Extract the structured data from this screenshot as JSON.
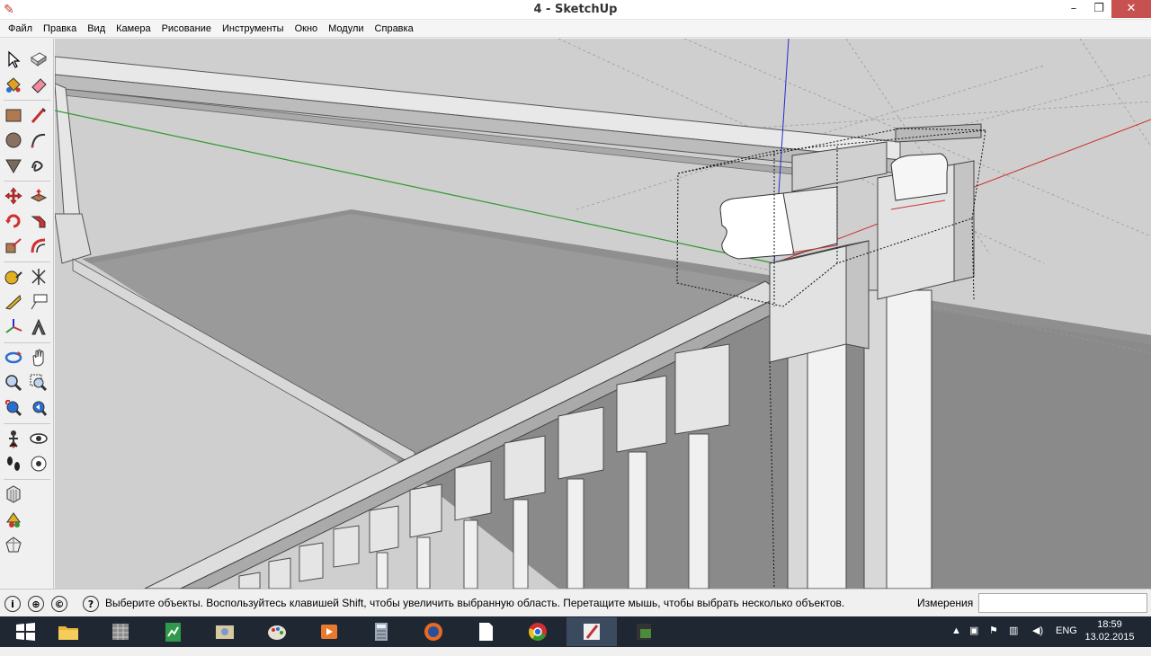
{
  "window": {
    "title": "4 - SketchUp",
    "minimize": "–",
    "restore": "❐",
    "close": "✕"
  },
  "menu": {
    "items": [
      "Файл",
      "Правка",
      "Вид",
      "Камера",
      "Рисование",
      "Инструменты",
      "Окно",
      "Модули",
      "Справка"
    ]
  },
  "tools": [
    "select-icon",
    "make-component-icon",
    "paint-bucket-icon",
    "eraser-icon",
    "rectangle-icon",
    "line-icon",
    "circle-icon",
    "arc-icon",
    "polygon-icon",
    "freehand-icon",
    "move-icon",
    "push-pull-icon",
    "rotate-icon",
    "follow-me-icon",
    "scale-icon",
    "offset-icon",
    "tape-measure-icon",
    "dimension-icon",
    "protractor-icon",
    "text-icon",
    "axes-icon",
    "3d-text-icon",
    "orbit-icon",
    "pan-icon",
    "zoom-icon",
    "zoom-window-icon",
    "zoom-extents-icon",
    "previous-view-icon",
    "position-camera-icon",
    "look-around-icon",
    "walk-icon",
    "section-plane-icon",
    "warehouse-icon",
    "extension-warehouse-icon",
    "share-model-icon"
  ],
  "status": {
    "message": "Выберите объекты. Воспользуйтесь клавишей Shift, чтобы увеличить выбранную область. Перетащите мышь, чтобы выбрать несколько объектов.",
    "measurements_label": "Измерения",
    "measurements_value": ""
  },
  "taskbar": {
    "apps": [
      "start-icon",
      "file-explorer-icon",
      "archive-icon",
      "sheets-icon",
      "photos-icon",
      "paint-icon",
      "media-player-icon",
      "calculator-icon",
      "firefox-icon",
      "document-icon",
      "chrome-icon",
      "sketchup-icon",
      "layout-icon"
    ],
    "language": "ENG",
    "time": "18:59",
    "date": "13.02.2015"
  },
  "colors": {
    "viewport_bg": "#c8c8c8",
    "axis_red": "#cc3333",
    "axis_green": "#2e9a2e",
    "axis_blue": "#2a2ad0",
    "taskbar": "#1f2733"
  }
}
